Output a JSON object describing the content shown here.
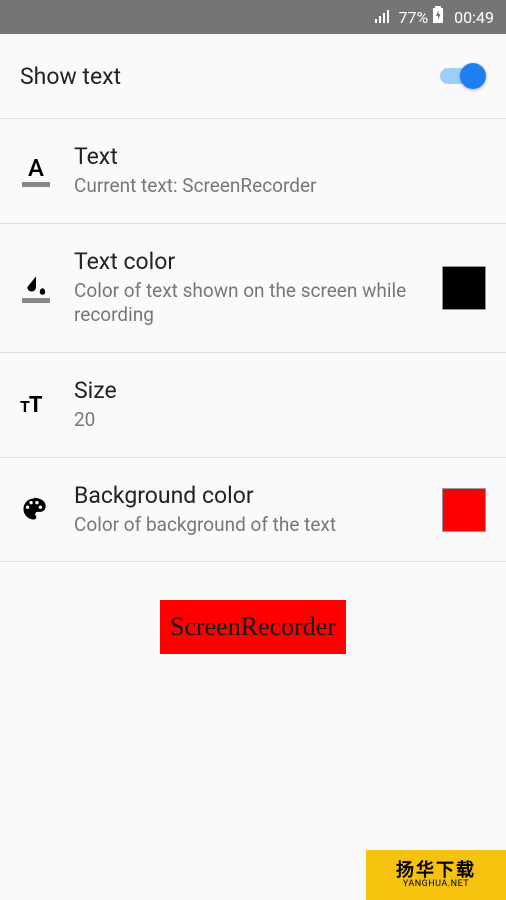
{
  "status": {
    "battery_pct": "77%",
    "time": "00:49"
  },
  "show_text": {
    "label": "Show text",
    "enabled": true
  },
  "text": {
    "title": "Text",
    "sub": "Current text: ScreenRecorder"
  },
  "text_color": {
    "title": "Text color",
    "sub": "Color of text shown on the screen while recording",
    "color": "#000000"
  },
  "size": {
    "title": "Size",
    "value": "20"
  },
  "bg_color": {
    "title": "Background color",
    "sub": "Color of background of the text",
    "color": "#ff0000"
  },
  "preview": {
    "text": "ScreenRecorder"
  },
  "watermark": {
    "zh": "扬华下载",
    "en": "YANGHUA.NET"
  }
}
